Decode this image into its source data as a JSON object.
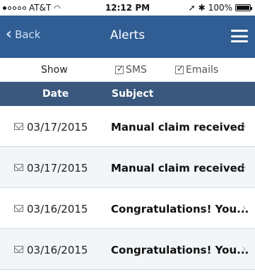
{
  "status_bar": {
    "carrier": "AT&T",
    "time": "12:12 PM",
    "battery": "100%"
  },
  "nav": {
    "back_label": "Back",
    "title": "Alerts"
  },
  "filter": {
    "show_label": "Show",
    "sms_label": "SMS",
    "emails_label": "Emails"
  },
  "table_header": {
    "date": "Date",
    "subject": "Subject"
  },
  "alerts": [
    {
      "date": "03/17/2015",
      "subject": "Manual claim received"
    },
    {
      "date": "03/17/2015",
      "subject": "Manual claim received"
    },
    {
      "date": "03/16/2015",
      "subject": "Congratulations! You..."
    },
    {
      "date": "03/16/2015",
      "subject": "Congratulations! You..."
    }
  ],
  "colors": {
    "nav_bg": "#2f5d94",
    "header_bg": "#3a587e"
  }
}
